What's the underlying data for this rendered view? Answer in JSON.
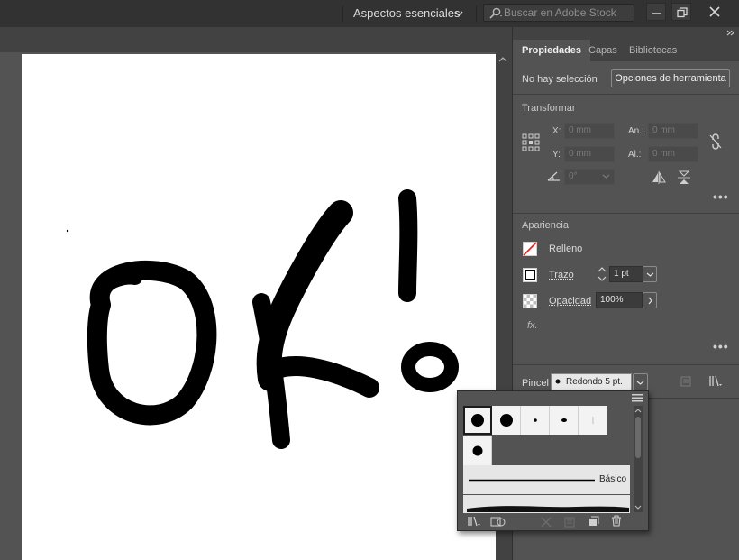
{
  "topbar": {
    "workspace": "Aspectos esenciales",
    "search_placeholder": "Buscar en Adobe Stock"
  },
  "panel": {
    "tabs": [
      "Propiedades",
      "Capas",
      "Bibliotecas"
    ],
    "no_selection": "No hay selección",
    "tool_options_button": "Opciones de herramienta",
    "transform": {
      "title": "Transformar",
      "x_label": "X:",
      "x_value": "0 mm",
      "y_label": "Y:",
      "y_value": "0 mm",
      "w_label": "An.:",
      "w_value": "0 mm",
      "h_label": "Al.:",
      "h_value": "0 mm",
      "angle_value": "0°"
    },
    "appearance": {
      "title": "Apariencia",
      "fill_label": "Relleno",
      "stroke_label": "Trazo",
      "stroke_value": "1 pt",
      "opacity_label": "Opacidad",
      "opacity_value": "100%",
      "fx_label": "fx."
    },
    "brush": {
      "label": "Pincel",
      "value": "Redondo 5 pt."
    }
  },
  "brush_popup": {
    "basic_label": "Básico"
  },
  "colors": {
    "ui_dark": "#323232",
    "panel_bg": "#535353",
    "fill_none_red": "#e02020"
  },
  "icons": [
    "chevron-down-icon",
    "search-icon",
    "minimize-icon",
    "restore-icon",
    "close-icon",
    "collapse-panels-icon",
    "reference-point-icon",
    "constrain-link-icon",
    "flip-horizontal-icon",
    "flip-vertical-icon",
    "more-options-icon",
    "fill-none-icon",
    "stroke-swatch-icon",
    "opacity-checker-icon",
    "brush-libraries-icon",
    "list-view-icon",
    "delete-icon"
  ]
}
